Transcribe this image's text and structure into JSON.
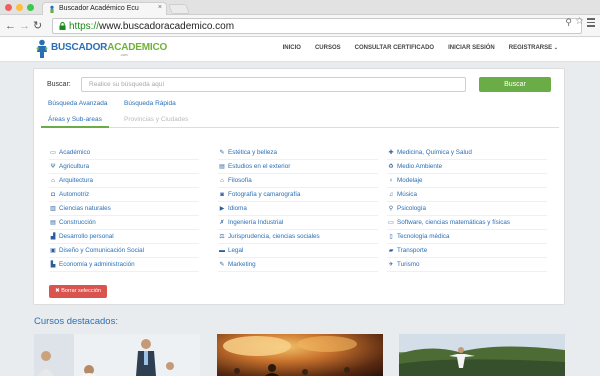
{
  "browser": {
    "tab_title": "Buscador Académico Ecu",
    "url_scheme": "https://",
    "url_host": "www.buscadoracademico.com"
  },
  "site": {
    "logo_part1": "BUSCADOR",
    "logo_part2": "ACADEMICO",
    "logo_sub": ".com",
    "nav": [
      "INICIO",
      "CURSOS",
      "CONSULTAR CERTIFICADO",
      "INICIAR SESIÓN",
      "REGISTRARSE"
    ]
  },
  "search": {
    "label": "Buscar:",
    "placeholder": "Realice su búsqueda aquí",
    "button": "Buscar",
    "link_advanced": "Búsqueda Avanzada",
    "link_fast": "Búsqueda Rápida"
  },
  "tabs": {
    "active": "Áreas y Sub-areas",
    "inactive": "Provincias y Ciudades"
  },
  "areas": {
    "col1": [
      {
        "icon": "laptop-icon",
        "glyph": "▭",
        "label": "Académico"
      },
      {
        "icon": "cutlery-icon",
        "glyph": "Ψ",
        "label": "Agricultura"
      },
      {
        "icon": "building-icon",
        "glyph": "⌂",
        "label": "Arquitectura"
      },
      {
        "icon": "car-icon",
        "glyph": "◘",
        "label": "Automotriz"
      },
      {
        "icon": "book-icon",
        "glyph": "▥",
        "label": "Ciencias naturales"
      },
      {
        "icon": "columns-icon",
        "glyph": "▤",
        "label": "Construcción"
      },
      {
        "icon": "chart-icon",
        "glyph": "▟",
        "label": "Desarrollo personal"
      },
      {
        "icon": "picture-icon",
        "glyph": "▣",
        "label": "Diseño y Comunicación Social"
      },
      {
        "icon": "bar-chart-icon",
        "glyph": "▙",
        "label": "Economía y administración"
      }
    ],
    "col2": [
      {
        "icon": "brush-icon",
        "glyph": "✎",
        "label": "Estética y belleza"
      },
      {
        "icon": "chat-icon",
        "glyph": "▤",
        "label": "Estudios en el exterior"
      },
      {
        "icon": "university-icon",
        "glyph": "⌂",
        "label": "Filosofía"
      },
      {
        "icon": "camera-icon",
        "glyph": "◙",
        "label": "Fotografía y camarografía"
      },
      {
        "icon": "flag-icon",
        "glyph": "▶",
        "label": "Idioma"
      },
      {
        "icon": "wrench-icon",
        "glyph": "✗",
        "label": "Ingeniería Industrial"
      },
      {
        "icon": "gavel-icon",
        "glyph": "⚖",
        "label": "Jurisprudencia, ciencias sociales"
      },
      {
        "icon": "briefcase-icon",
        "glyph": "▬",
        "label": "Legal"
      },
      {
        "icon": "edit-icon",
        "glyph": "✎",
        "label": "Marketing"
      }
    ],
    "col3": [
      {
        "icon": "medkit-icon",
        "glyph": "✚",
        "label": "Medicina, Química y Salud"
      },
      {
        "icon": "recycle-icon",
        "glyph": "♻",
        "label": "Medio Ambiente"
      },
      {
        "icon": "female-icon",
        "glyph": "♀",
        "label": "Modelaje"
      },
      {
        "icon": "music-icon",
        "glyph": "♫",
        "label": "Música"
      },
      {
        "icon": "search-icon",
        "glyph": "⚲",
        "label": "Psicología"
      },
      {
        "icon": "desktop-icon",
        "glyph": "▭",
        "label": "Software, ciencias matemáticas y físicas"
      },
      {
        "icon": "tablet-icon",
        "glyph": "▯",
        "label": "Tecnología médica"
      },
      {
        "icon": "truck-icon",
        "glyph": "▰",
        "label": "Transporte"
      },
      {
        "icon": "plane-icon",
        "glyph": "✈",
        "label": "Turismo"
      }
    ]
  },
  "clear_button": "✖ Borrar selección",
  "featured": {
    "title": "Cursos destacados:"
  },
  "colors": {
    "accent_green": "#6aad47",
    "link_blue": "#2a6fb5",
    "danger_red": "#d9534f"
  }
}
